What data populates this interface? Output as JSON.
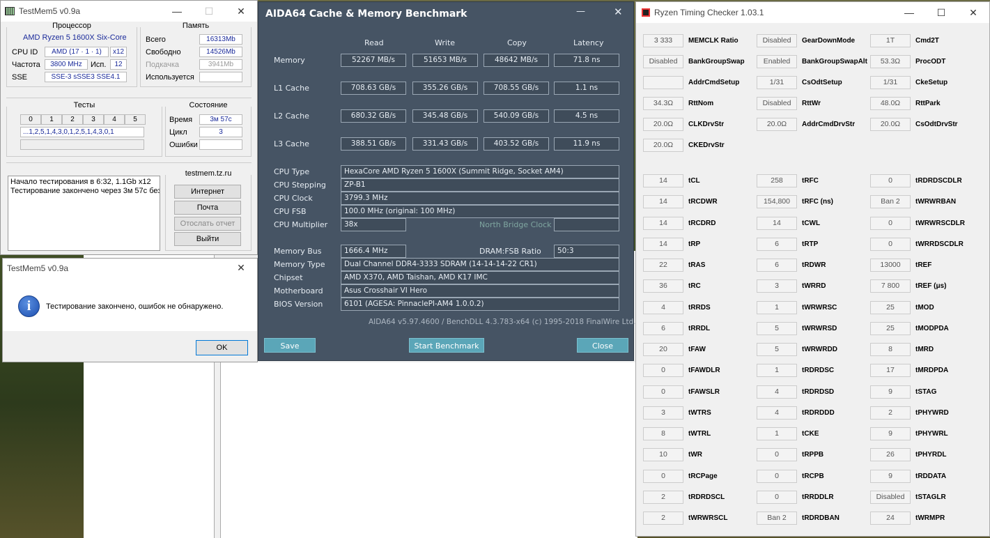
{
  "testmem": {
    "title": "TestMem5 v0.9a",
    "cpu_group": "Процессор",
    "cpu_name": "AMD Ryzen 5 1600X Six-Core",
    "cpuid_label": "CPU ID",
    "cpuid_value": "AMD  (17 · 1 · 1)",
    "cpuid_x": "x12",
    "freq_label": "Частота",
    "freq_value": "3800 MHz",
    "used_label": "Исп.",
    "used_value": "12",
    "sse_label": "SSE",
    "sse_value": "SSE-3 sSSE3 SSE4.1",
    "mem_group": "Память",
    "total_label": "Всего",
    "total_value": "16313Mb",
    "free_label": "Свободно",
    "free_value": "14526Mb",
    "swap_label": "Подкачка",
    "swap_value": "3941Mb",
    "used_mem_label": "Используется",
    "used_mem_value": "",
    "tests_group": "Тесты",
    "tests": [
      "0",
      "1",
      "2",
      "3",
      "4",
      "5"
    ],
    "test_seq": "...1,2,5,1,4,3,0,1,2,5,1,4,3,0,1",
    "state_group": "Состояние",
    "time_label": "Время",
    "time_value": "3м 57с",
    "cycle_label": "Цикл",
    "cycle_value": "3",
    "errors_label": "Ошибки",
    "errors_value": "",
    "log_line1": "Начало тестирования в 6:32, 1.1Gb x12",
    "log_line2": "Тестирование закончено через 3м 57с без",
    "site_group": "testmem.tz.ru",
    "btn_internet": "Интернет",
    "btn_mail": "Почта",
    "btn_report": "Отослать отчет",
    "btn_exit": "Выйти"
  },
  "dialog": {
    "title": "TestMem5 v0.9a",
    "message": "Тестирование закончено, ошибок не обнаружено.",
    "ok": "OK"
  },
  "aida": {
    "title": "AIDA64 Cache & Memory Benchmark",
    "cols": [
      "Read",
      "Write",
      "Copy",
      "Latency"
    ],
    "rows": [
      {
        "label": "Memory",
        "vals": [
          "52267 MB/s",
          "51653 MB/s",
          "48642 MB/s",
          "71.8 ns"
        ]
      },
      {
        "label": "L1 Cache",
        "vals": [
          "708.63 GB/s",
          "355.26 GB/s",
          "708.55 GB/s",
          "1.1 ns"
        ]
      },
      {
        "label": "L2 Cache",
        "vals": [
          "680.32 GB/s",
          "345.48 GB/s",
          "540.09 GB/s",
          "4.5 ns"
        ]
      },
      {
        "label": "L3 Cache",
        "vals": [
          "388.51 GB/s",
          "331.43 GB/s",
          "403.52 GB/s",
          "11.9 ns"
        ]
      }
    ],
    "cpu_type_label": "CPU Type",
    "cpu_type": "HexaCore AMD Ryzen 5 1600X  (Summit Ridge, Socket AM4)",
    "cpu_stepping_label": "CPU Stepping",
    "cpu_stepping": "ZP-B1",
    "cpu_clock_label": "CPU Clock",
    "cpu_clock": "3799.3 MHz",
    "cpu_fsb_label": "CPU FSB",
    "cpu_fsb": "100.0 MHz  (original: 100 MHz)",
    "cpu_mult_label": "CPU Multiplier",
    "cpu_mult": "38x",
    "nb_clock_label": "North Bridge Clock",
    "nb_clock": "",
    "mem_bus_label": "Memory Bus",
    "mem_bus": "1666.4 MHz",
    "dram_ratio_label": "DRAM:FSB Ratio",
    "dram_ratio": "50:3",
    "mem_type_label": "Memory Type",
    "mem_type": "Dual Channel DDR4-3333 SDRAM  (14-14-14-22 CR1)",
    "chipset_label": "Chipset",
    "chipset": "AMD X370, AMD Taishan, AMD K17 IMC",
    "mobo_label": "Motherboard",
    "mobo": "Asus Crosshair VI Hero",
    "bios_label": "BIOS Version",
    "bios": "6101  (AGESA: PinnaclePI-AM4 1.0.0.2)",
    "footer": "AIDA64 v5.97.4600 / BenchDLL 4.3.783-x64  (c) 1995-2018 FinalWire Ltd.",
    "btn_save": "Save",
    "btn_start": "Start Benchmark",
    "btn_close": "Close"
  },
  "rtc": {
    "title": "Ryzen Timing Checker 1.03.1",
    "top": [
      [
        [
          "3 333",
          "MEMCLK Ratio"
        ],
        [
          "Disabled",
          "GearDownMode"
        ],
        [
          "1T",
          "Cmd2T"
        ]
      ],
      [
        [
          "Disabled",
          "BankGroupSwap"
        ],
        [
          "Enabled",
          "BankGroupSwapAlt"
        ],
        [
          "53.3Ω",
          "ProcODT"
        ]
      ],
      [
        [
          "",
          "AddrCmdSetup"
        ],
        [
          "1/31",
          "CsOdtSetup"
        ],
        [
          "1/31",
          "CkeSetup"
        ]
      ],
      [
        [
          "34.3Ω",
          "RttNom"
        ],
        [
          "Disabled",
          "RttWr"
        ],
        [
          "48.0Ω",
          "RttPark"
        ]
      ],
      [
        [
          "20.0Ω",
          "CLKDrvStr"
        ],
        [
          "20.0Ω",
          "AddrCmdDrvStr"
        ],
        [
          "20.0Ω",
          "CsOdtDrvStr"
        ]
      ],
      [
        [
          "20.0Ω",
          "CKEDrvStr"
        ]
      ]
    ],
    "timings": [
      [
        [
          "14",
          "tCL"
        ],
        [
          "258",
          "tRFC"
        ],
        [
          "0",
          "tRDRDSCDLR"
        ]
      ],
      [
        [
          "14",
          "tRCDWR"
        ],
        [
          "154,800",
          "tRFC (ns)"
        ],
        [
          "Ban 2",
          "tWRWRBAN"
        ]
      ],
      [
        [
          "14",
          "tRCDRD"
        ],
        [
          "14",
          "tCWL"
        ],
        [
          "0",
          "tWRWRSCDLR"
        ]
      ],
      [
        [
          "14",
          "tRP"
        ],
        [
          "6",
          "tRTP"
        ],
        [
          "0",
          "tWRRDSCDLR"
        ]
      ],
      [
        [
          "22",
          "tRAS"
        ],
        [
          "6",
          "tRDWR"
        ],
        [
          "13000",
          "tREF"
        ]
      ],
      [
        [
          "36",
          "tRC"
        ],
        [
          "3",
          "tWRRD"
        ],
        [
          "7 800",
          "tREF (μs)"
        ]
      ],
      [
        [
          "4",
          "tRRDS"
        ],
        [
          "1",
          "tWRWRSC"
        ],
        [
          "25",
          "tMOD"
        ]
      ],
      [
        [
          "6",
          "tRRDL"
        ],
        [
          "5",
          "tWRWRSD"
        ],
        [
          "25",
          "tMODPDA"
        ]
      ],
      [
        [
          "20",
          "tFAW"
        ],
        [
          "5",
          "tWRWRDD"
        ],
        [
          "8",
          "tMRD"
        ]
      ],
      [
        [
          "0",
          "tFAWDLR"
        ],
        [
          "1",
          "tRDRDSC"
        ],
        [
          "17",
          "tMRDPDA"
        ]
      ],
      [
        [
          "0",
          "tFAWSLR"
        ],
        [
          "4",
          "tRDRDSD"
        ],
        [
          "9",
          "tSTAG"
        ]
      ],
      [
        [
          "3",
          "tWTRS"
        ],
        [
          "4",
          "tRDRDDD"
        ],
        [
          "2",
          "tPHYWRD"
        ]
      ],
      [
        [
          "8",
          "tWTRL"
        ],
        [
          "1",
          "tCKE"
        ],
        [
          "9",
          "tPHYWRL"
        ]
      ],
      [
        [
          "10",
          "tWR"
        ],
        [
          "0",
          "tRPPB"
        ],
        [
          "26",
          "tPHYRDL"
        ]
      ],
      [
        [
          "0",
          "tRCPage"
        ],
        [
          "0",
          "tRCPB"
        ],
        [
          "9",
          "tRDDATA"
        ]
      ],
      [
        [
          "2",
          "tRDRDSCL"
        ],
        [
          "0",
          "tRRDDLR"
        ],
        [
          "Disabled",
          "tSTAGLR"
        ]
      ],
      [
        [
          "2",
          "tWRWRSCL"
        ],
        [
          "Ban 2",
          "tRDRDBAN"
        ],
        [
          "24",
          "tWRMPR"
        ]
      ]
    ]
  }
}
